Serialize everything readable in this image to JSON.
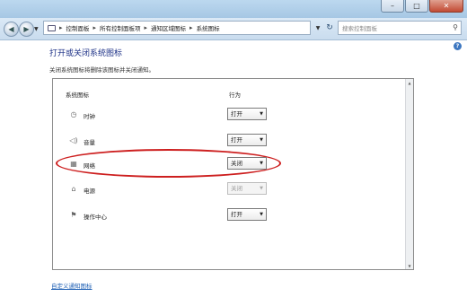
{
  "window": {
    "minimize_glyph": "–",
    "maximize_glyph": "□",
    "close_glyph": "✕"
  },
  "address_bar": {
    "crumbs": [
      "控制面板",
      "所有控制面板项",
      "通知区域图标",
      "系统图标"
    ],
    "separator": "▸",
    "refresh_glyph": "↻"
  },
  "search": {
    "placeholder": "搜索控制面板"
  },
  "main": {
    "title": "打开或关闭系统图标",
    "subtitle": "关闭系统图标将删除该图标并关闭通知。",
    "column_icons": "系统图标",
    "column_behavior": "行为",
    "rows": [
      {
        "label": "时钟",
        "value": "打开",
        "icon": "clock-icon",
        "disabled": false
      },
      {
        "label": "音量",
        "value": "打开",
        "icon": "volume-icon",
        "disabled": false
      },
      {
        "label": "网络",
        "value": "关闭",
        "icon": "network-icon",
        "disabled": false
      },
      {
        "label": "电源",
        "value": "关闭",
        "icon": "power-icon",
        "disabled": true
      },
      {
        "label": "操作中心",
        "value": "打开",
        "icon": "action-center-flag-icon",
        "disabled": false
      }
    ],
    "customize_link": "自定义通知图标"
  },
  "colors": {
    "title_blue": "#1e3287",
    "highlight_red": "#cd1f1f",
    "link_blue": "#1e5fb4"
  }
}
